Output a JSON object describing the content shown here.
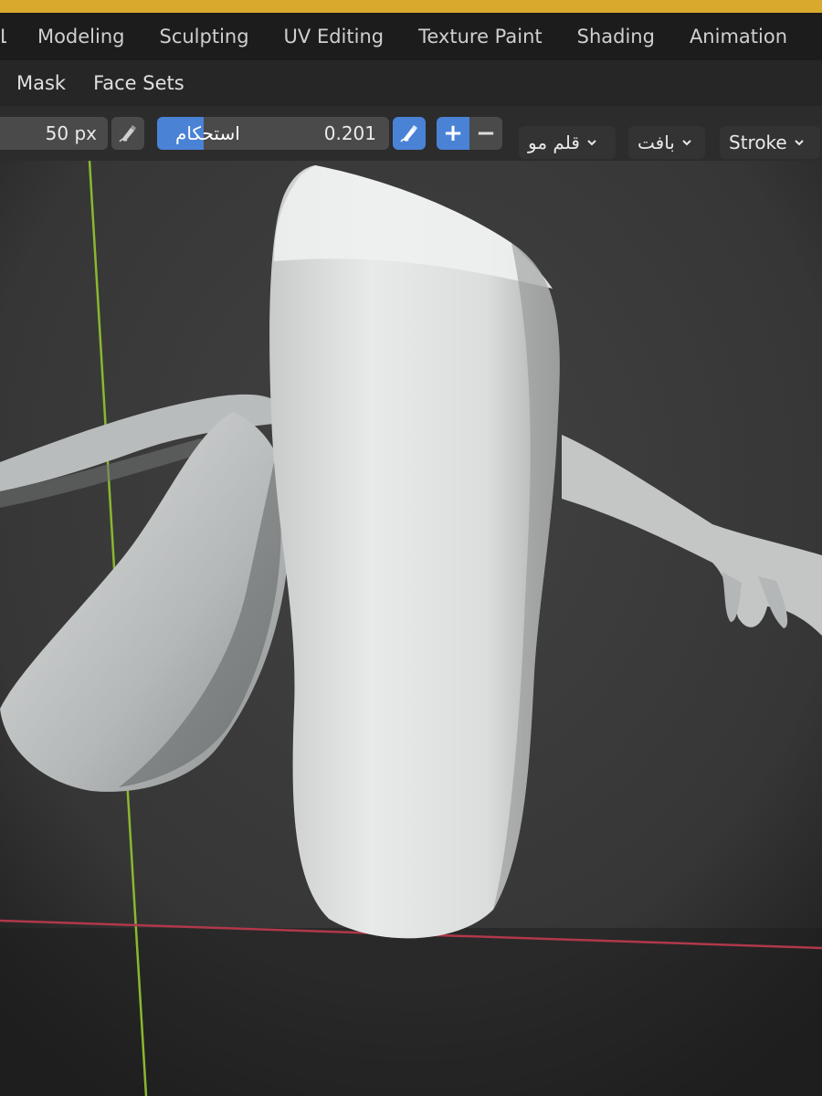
{
  "workspace_tabs": [
    {
      "label": "Layout"
    },
    {
      "label": "Modeling"
    },
    {
      "label": "Sculpting"
    },
    {
      "label": "UV Editing"
    },
    {
      "label": "Texture Paint"
    },
    {
      "label": "Shading"
    },
    {
      "label": "Animation"
    }
  ],
  "menu": {
    "items": [
      {
        "label": "Mask"
      },
      {
        "label": "Face Sets"
      }
    ]
  },
  "tool_settings": {
    "radius": "50 px",
    "strength_label": "استحکام",
    "strength_value": "0.201",
    "strength_fraction": 0.201,
    "add_label": "+",
    "subtract_label": "−",
    "brush_dropdown": "قلم مو",
    "texture_dropdown": "بافت",
    "stroke_dropdown": "Stroke"
  },
  "icons": {
    "pressure": "pen-pressure-icon",
    "dropdown": "chevron-down-icon"
  },
  "colors": {
    "accent": "#4a82d6",
    "top_strip": "#d8a92c",
    "viewport_bg": "#3a3a3a",
    "mesh": "#d4d6d6",
    "x_axis": "#b0384a",
    "y_axis": "#8ab830"
  }
}
